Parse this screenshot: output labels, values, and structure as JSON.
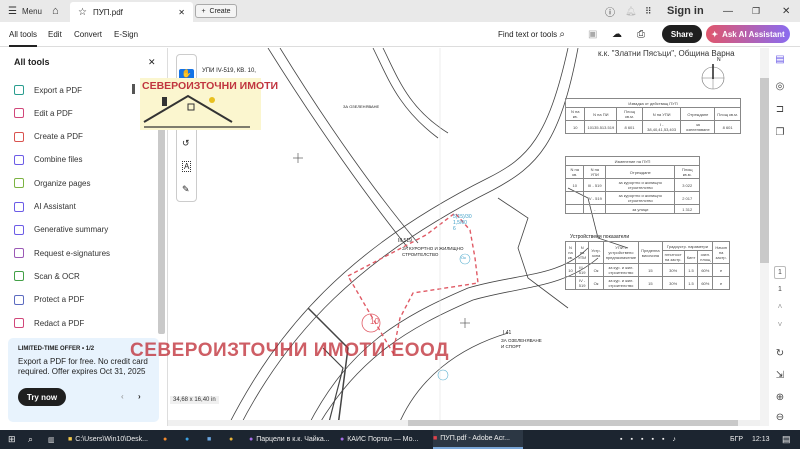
{
  "titlebar": {
    "menu": "Menu",
    "tab_title": "ПУП.pdf",
    "create": "Create",
    "sign_in": "Sign in"
  },
  "toolbar": {
    "tabs": [
      "All tools",
      "Edit",
      "Convert",
      "E-Sign"
    ],
    "find": "Find text or tools",
    "share": "Share",
    "ask_ai": "Ask AI Assistant"
  },
  "left_panel": {
    "title": "All tools",
    "tools": [
      "Export a PDF",
      "Edit a PDF",
      "Create a PDF",
      "Combine files",
      "Organize pages",
      "AI Assistant",
      "Generative summary",
      "Request e-signatures",
      "Scan & OCR",
      "Protect a PDF",
      "Redact a PDF"
    ],
    "tool_colors": [
      "#2a9d8f",
      "#d1477a",
      "#d9534f",
      "#6c5ce7",
      "#7cb342",
      "#6c5ce7",
      "#6c5ce7",
      "#9b59b6",
      "#43a047",
      "#5c6bc0",
      "#d1477a"
    ],
    "offer": {
      "label": "LIMITED-TIME OFFER • 1/2",
      "text": "Export a PDF for free. No credit card required. Offer expires Oct 31, 2025",
      "button": "Try now"
    }
  },
  "document": {
    "header_text": "к.к. \"Златни Пясъци\", Община Варна",
    "north": "N",
    "top_left_text": "УПИ IV-519, КВ. 10,",
    "logo_text": "СЕВЕРОИЗТОЧНИ ИМОТИ",
    "watermark": "СЕВЕРОИЗТОЧНИ ИМОТИ ЕООД",
    "plot_number": "10",
    "plot_label": "III 519",
    "plot_use": "ЗА КУРОРТНО И ЖИЛИЩНО СТРОИТЕЛСТВО",
    "zone_label": "Ок",
    "zone_params": [
      "5(15)/30",
      "1,5/60",
      "6"
    ],
    "green_label": "I 41",
    "green_use": "ЗА ОЗЕЛЕНЯВАНЕ И СПОРТ",
    "green_top": "ЗА ОЗЕЛЕНЯВАНЕ",
    "dimensions": "34,68 x 16,40 in",
    "table1": {
      "title": "Извадка от действащ ПУП",
      "headers": [
        "N на кв.",
        "N на ПИ",
        "Площ кв.м.",
        "N на УПИ",
        "Отреждане",
        "Площ кв.м."
      ],
      "row": [
        "10",
        "10135.513.519",
        "8 601",
        "I - 38,40,41,53,403",
        "за озеленяване",
        "8 601"
      ]
    },
    "table2": {
      "title": "Изменение на ПУП",
      "headers": [
        "N на кв.",
        "N на УПИ",
        "Отреждане",
        "Площ кв.м."
      ],
      "rows": [
        [
          "10",
          "III - 519",
          "за курортно и жилищно строителство",
          "3 022"
        ],
        [
          "",
          "IV - 519",
          "за курортно и жилищно строителство",
          "2 017"
        ],
        [
          "",
          "-",
          "за улици",
          "1 312"
        ]
      ]
    },
    "table3": {
      "title": "Устройствени показатели",
      "headers": [
        "N на кв.",
        "N на УПИ",
        "Устр. зона",
        "УПИ с устройствено предназначение",
        "Пределна височина",
        "Градоустр. параметри",
        "Начин на застр."
      ],
      "sub": [
        "плътност на застр.",
        "Кинт",
        "озел. площ"
      ],
      "rows": [
        [
          "10",
          "III - 519",
          "Ок",
          "за кур. и жил. строителство",
          "15",
          "30%",
          "1.5",
          "60%",
          "е"
        ],
        [
          "",
          "IV - 519",
          "Ок",
          "за кур. и жил. строителство",
          "15",
          "30%",
          "1.5",
          "60%",
          "е"
        ]
      ]
    }
  },
  "right_rail": {
    "page_current": "1",
    "page_total": "1"
  },
  "taskbar": {
    "items": [
      "C:\\Users\\Win10\\Desk...",
      "Парцели в к.к. Чайка...",
      "КАИС Портал — Мо...",
      "ПУП.pdf - Adobe Acr..."
    ],
    "lang": "БГР",
    "time": "12:13"
  }
}
